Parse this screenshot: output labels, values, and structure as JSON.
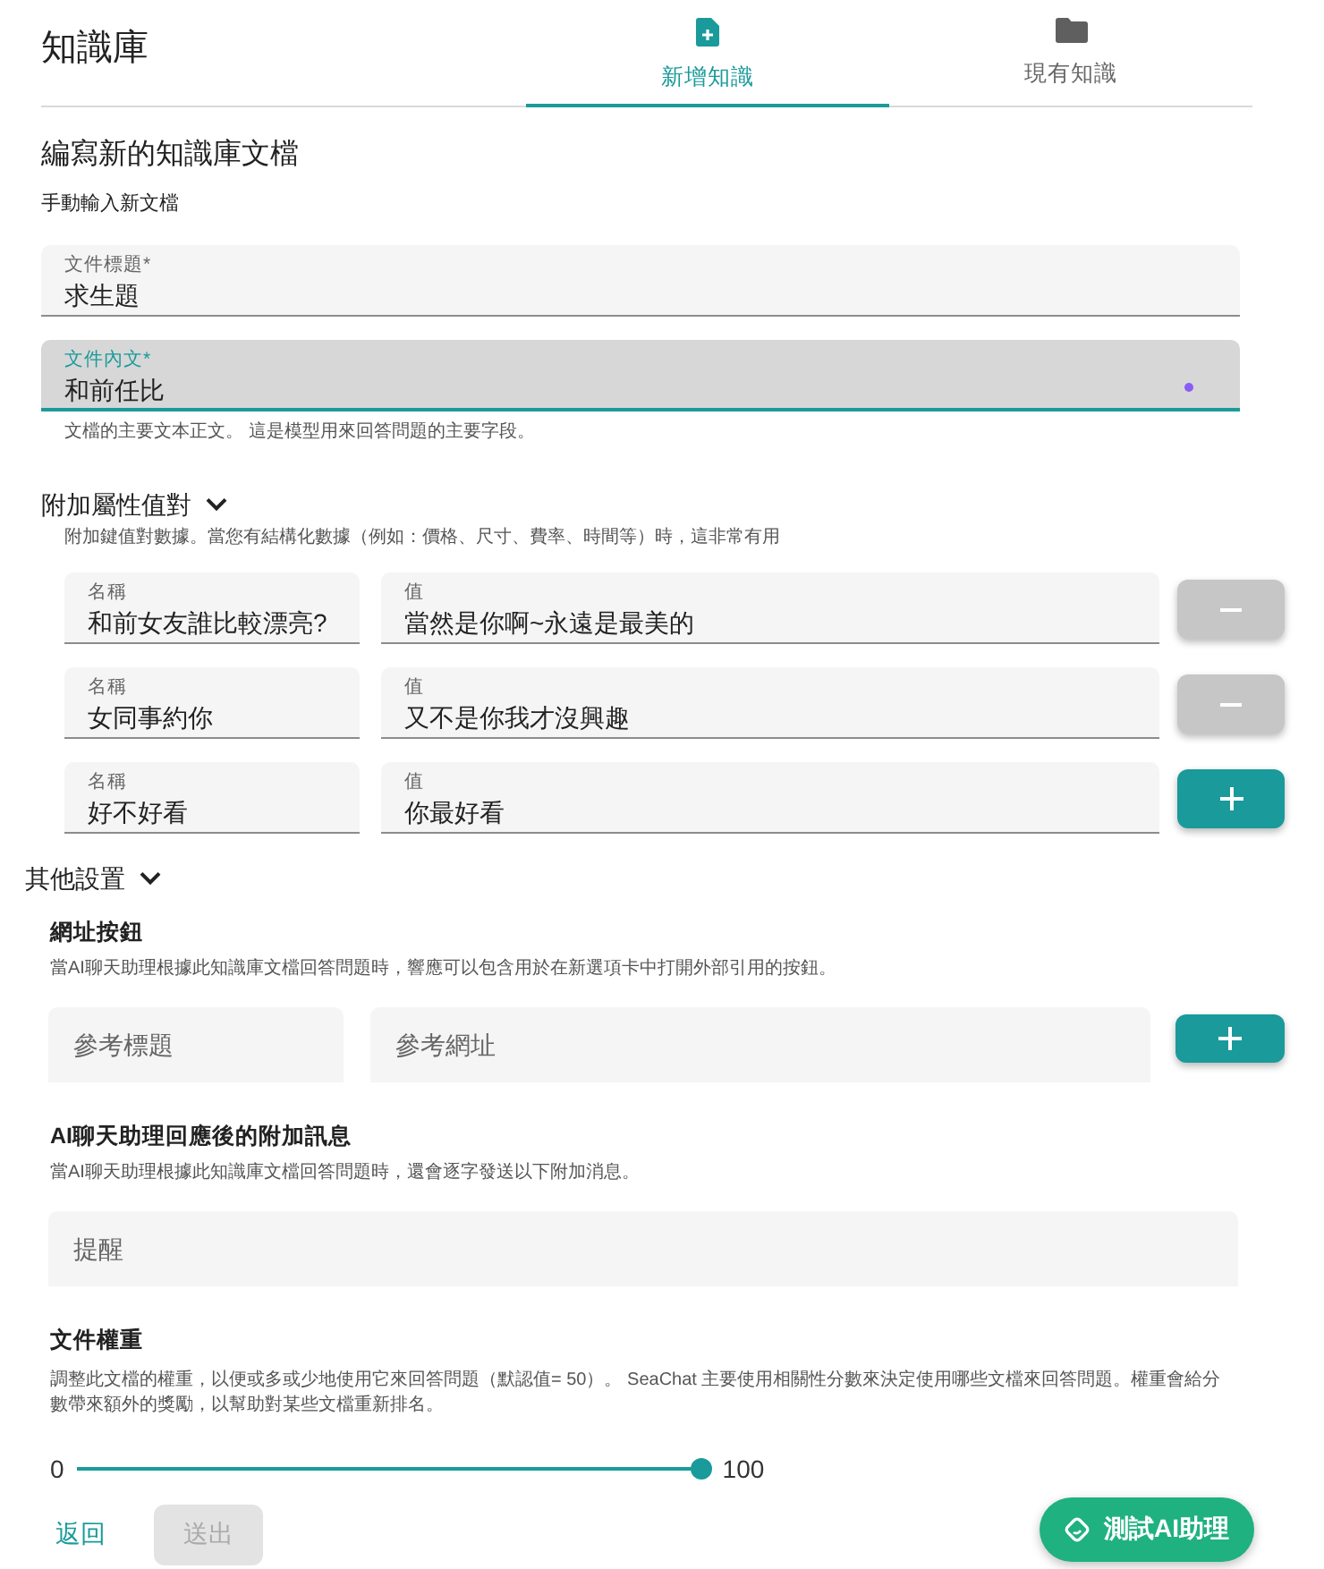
{
  "header": {
    "title": "知識庫"
  },
  "tabs": [
    {
      "label": "新增知識",
      "selected": true
    },
    {
      "label": "現有知識",
      "selected": false
    }
  ],
  "editor": {
    "heading": "編寫新的知識庫文檔",
    "subheading": "手動輸入新文檔"
  },
  "fields": [
    {
      "label": "文件標題*",
      "value": "求生題",
      "focused": false
    },
    {
      "label": "文件內文*",
      "value": "和前任比",
      "focused": true,
      "helper": "文檔的主要文本正文。 這是模型用來回答問題的主要字段。"
    }
  ],
  "attributes": {
    "title": "附加屬性值對",
    "expanded": true,
    "description": "附加鍵值對數據。當您有結構化數據（例如：價格、尺寸、費率、時間等）時，這非常有用",
    "rows": [
      {
        "name_label": "名稱",
        "name": "和前女友誰比較漂亮?",
        "value_label": "值",
        "value": "當然是你啊~永遠是最美的",
        "kind": "remove"
      },
      {
        "name_label": "名稱",
        "name": "女同事約你",
        "value_label": "值",
        "value": "又不是你我才沒興趣",
        "kind": "remove"
      },
      {
        "name_label": "名稱",
        "name": "好不好看",
        "value_label": "值",
        "value": "你最好看",
        "kind": "add"
      }
    ]
  },
  "other_settings": {
    "title": "其他設置",
    "expanded": true,
    "url_buttons": {
      "title": "網址按鈕",
      "description": "當AI聊天助理根據此知識庫文檔回答問題時，響應可以包含用於在新選項卡中打開外部引用的按鈕。",
      "title_placeholder": "參考標題",
      "url_placeholder": "參考網址"
    },
    "extra_message": {
      "title": "AI聊天助理回應後的附加訊息",
      "description": "當AI聊天助理根據此知識庫文檔回答問題時，還會逐字發送以下附加消息。",
      "placeholder": "提醒"
    },
    "weight": {
      "title": "文件權重",
      "description": "調整此文檔的權重，以便或多或少地使用它來回答問題（默認值= 50）。 SeaChat 主要使用相關性分數來決定使用哪些文檔來回答問題。權重會給分數帶來額外的獎勵，以幫助對某些文檔重新排名。",
      "min_label": "0",
      "max_label": "100",
      "level": 1
    }
  },
  "footer": {
    "back": "返回",
    "submit": {
      "label": "送出",
      "disabled": true
    }
  },
  "assistant_button": {
    "label": "測試AI助理"
  }
}
